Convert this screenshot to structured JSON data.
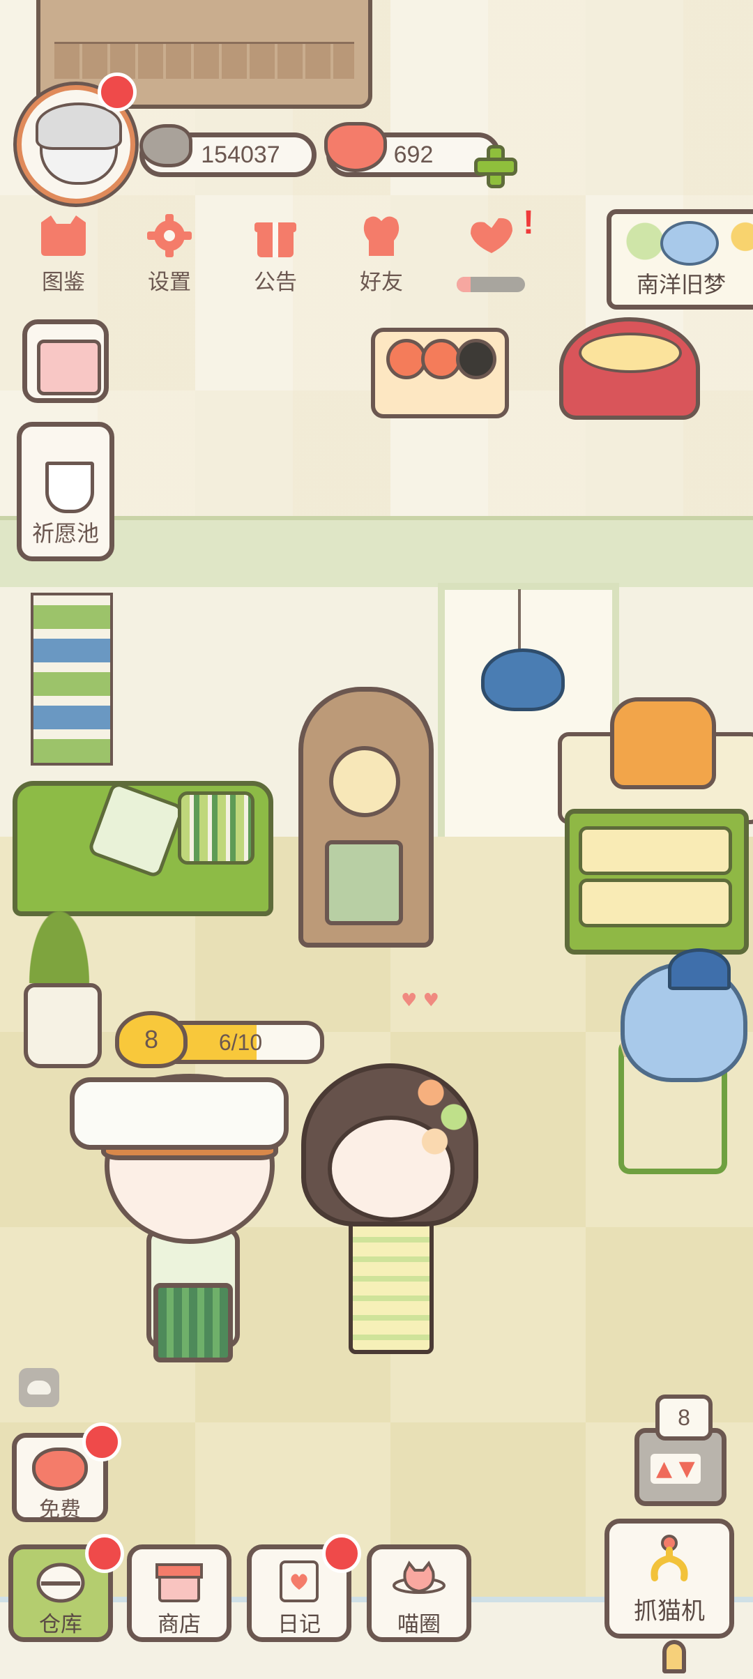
{
  "hud": {
    "currency_fish": "154037",
    "currency_hearts": "692"
  },
  "menu": {
    "items": [
      {
        "label": "图鉴",
        "icon": "cat-book-icon"
      },
      {
        "label": "设置",
        "icon": "gear-icon"
      },
      {
        "label": "公告",
        "icon": "gift-icon"
      },
      {
        "label": "好友",
        "icon": "friends-icon"
      },
      {
        "label": "",
        "icon": "heart-hands-icon",
        "progress": 0.2
      }
    ]
  },
  "event_banner": {
    "label": "南洋旧梦"
  },
  "side": {
    "calendar_icon": "calendar-edit-icon",
    "wish_label": "祈愿池"
  },
  "character": {
    "level": "8",
    "xp_text": "6/10",
    "xp_progress": 0.6
  },
  "free": {
    "label": "免费"
  },
  "claw_counter": "8",
  "tabbar": {
    "items": [
      {
        "label": "仓库",
        "icon": "storage-icon"
      },
      {
        "label": "商店",
        "icon": "shop-icon"
      },
      {
        "label": "日记",
        "icon": "diary-icon"
      },
      {
        "label": "喵圈",
        "icon": "cat-planet-icon"
      }
    ]
  },
  "claw": {
    "label": "抓猫机"
  },
  "colors": {
    "outline": "#6b5750",
    "coral": "#f47c6a",
    "notification_red": "#ef4a4a",
    "active_tab": "#b4cd6f",
    "xp_yellow": "#f8c83b"
  }
}
